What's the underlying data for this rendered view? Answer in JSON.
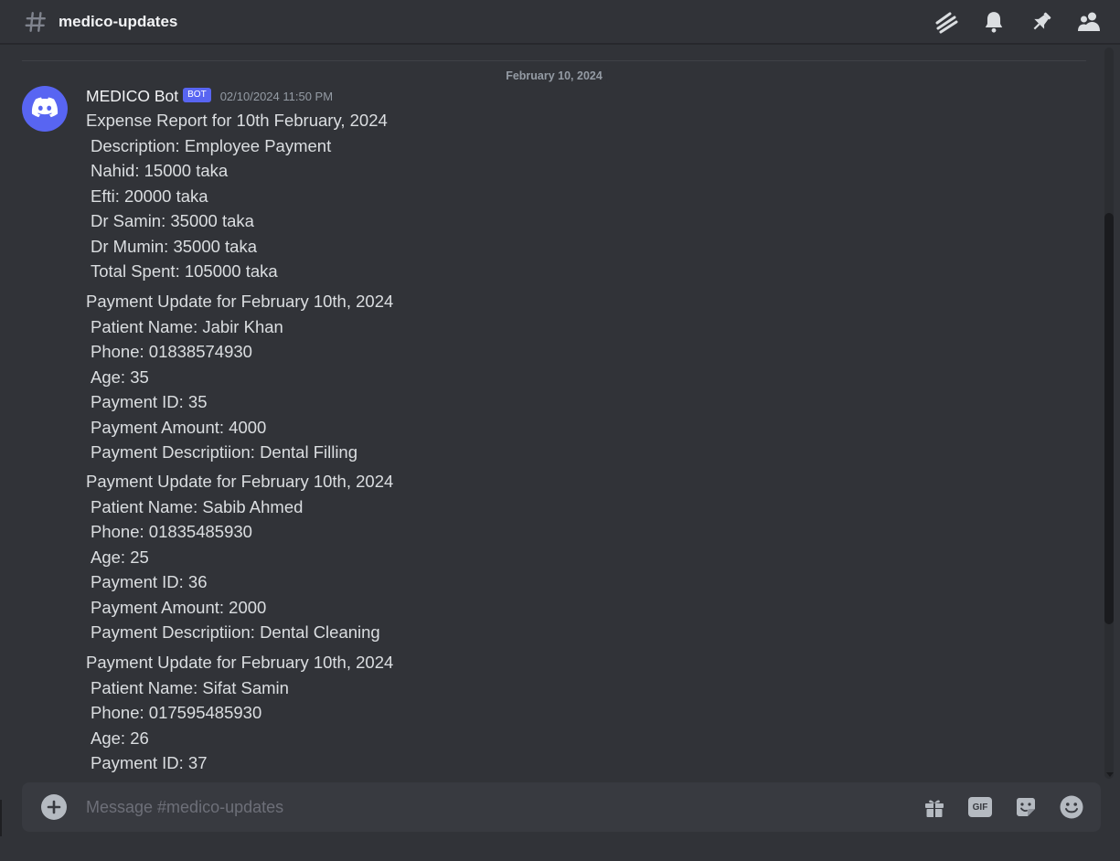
{
  "header": {
    "channel_name": "medico-updates"
  },
  "date_divider": "February 10, 2024",
  "message": {
    "username": "MEDICO Bot",
    "bot_tag": "BOT",
    "timestamp": "02/10/2024 11:50 PM",
    "blocks": [
      {
        "title": "Expense Report for 10th February, 2024",
        "lines": [
          "Description: Employee Payment",
          "Nahid: 15000 taka",
          "Efti: 20000 taka",
          "Dr Samin: 35000 taka",
          "Dr Mumin: 35000 taka",
          "Total Spent: 105000 taka"
        ]
      },
      {
        "title": "Payment Update for February 10th, 2024",
        "lines": [
          "Patient Name: Jabir Khan",
          "Phone: 01838574930",
          "Age: 35",
          "Payment ID: 35",
          "Payment Amount: 4000",
          "Payment Descriptiion: Dental Filling"
        ]
      },
      {
        "title": "Payment Update for February 10th, 2024",
        "lines": [
          "Patient Name: Sabib Ahmed",
          "Phone: 01835485930",
          "Age: 25",
          "Payment ID: 36",
          "Payment Amount: 2000",
          "Payment Descriptiion: Dental Cleaning"
        ]
      },
      {
        "title": "Payment Update for February 10th, 2024",
        "lines": [
          "Patient Name: Sifat Samin",
          "Phone: 017595485930",
          "Age: 26",
          "Payment ID: 37"
        ]
      }
    ]
  },
  "composer": {
    "placeholder": "Message #medico-updates",
    "gif_label": "GIF"
  },
  "colors": {
    "background": "#313338",
    "accent": "#5865f2",
    "composer_bg": "#383a40"
  },
  "icons": {
    "header": [
      "hash-icon",
      "threads-icon",
      "bell-icon",
      "pin-icon",
      "members-icon"
    ],
    "composer": [
      "plus-icon",
      "gift-icon",
      "gif-icon",
      "sticker-icon",
      "emoji-icon"
    ],
    "avatar": "discord-logo-icon"
  }
}
